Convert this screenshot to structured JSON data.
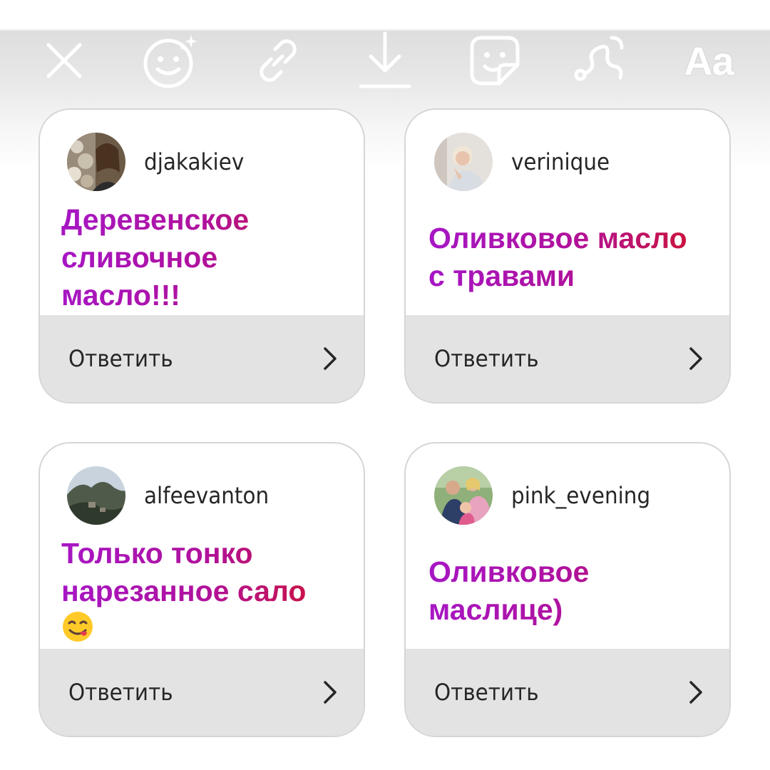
{
  "toolbar": {
    "tools": [
      {
        "icon": "close-icon"
      },
      {
        "icon": "face-effects-icon"
      },
      {
        "icon": "link-icon"
      },
      {
        "icon": "download-icon"
      },
      {
        "icon": "sticker-icon"
      },
      {
        "icon": "draw-icon"
      },
      {
        "icon": "text-icon",
        "label": "Aa"
      }
    ]
  },
  "cards": [
    {
      "username": "djakakiev",
      "question_lines": [
        "Деревенское",
        "сливочное",
        "масло!!!"
      ],
      "reply_label": "Ответить"
    },
    {
      "username": "verinique",
      "question_lines": [
        "Оливковое масло",
        "с травами"
      ],
      "reply_label": "Ответить"
    },
    {
      "username": "alfeevanton",
      "question_lines": [
        "Только тонко",
        "нарезанное сало"
      ],
      "question_emoji": "face-savoring-food",
      "reply_label": "Ответить"
    },
    {
      "username": "pink_evening",
      "question_lines": [
        "Оливковое",
        "маслице)"
      ],
      "reply_label": "Ответить"
    }
  ],
  "colors": {
    "question_gradient_start": "#a616c4",
    "question_gradient_end": "#d0142b",
    "reply_bar": "#e3e3e3",
    "card_border": "#d6d6d6"
  }
}
